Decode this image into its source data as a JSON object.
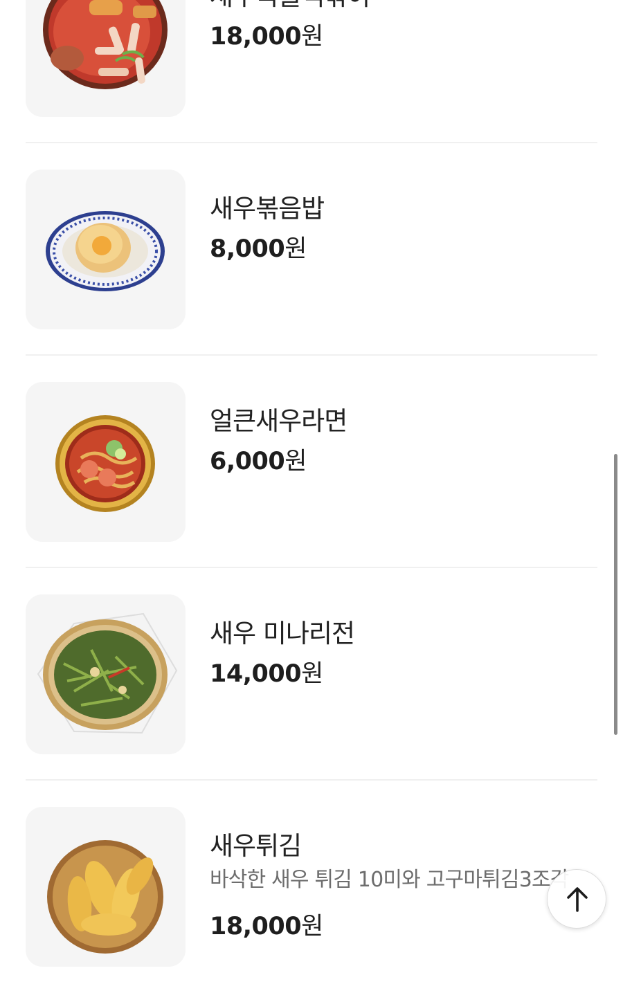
{
  "menu": {
    "currency_unit": "원",
    "items": [
      {
        "name": "새우국물떡볶이",
        "price": "18,000",
        "description": "",
        "image_icon": "tteokbokki-dish-icon"
      },
      {
        "name": "새우볶음밥",
        "price": "8,000",
        "description": "",
        "image_icon": "fried-rice-dish-icon"
      },
      {
        "name": "얼큰새우라면",
        "price": "6,000",
        "description": "",
        "image_icon": "ramen-pot-icon"
      },
      {
        "name": "새우 미나리전",
        "price": "14,000",
        "description": "",
        "image_icon": "minari-pancake-icon"
      },
      {
        "name": "새우튀김",
        "price": "18,000",
        "description": "바삭한 새우 튀김 10미와 고구마튀김3조각",
        "image_icon": "fried-shrimp-basket-icon"
      }
    ]
  },
  "scroll_top_button": {
    "icon": "arrow-up-icon"
  }
}
